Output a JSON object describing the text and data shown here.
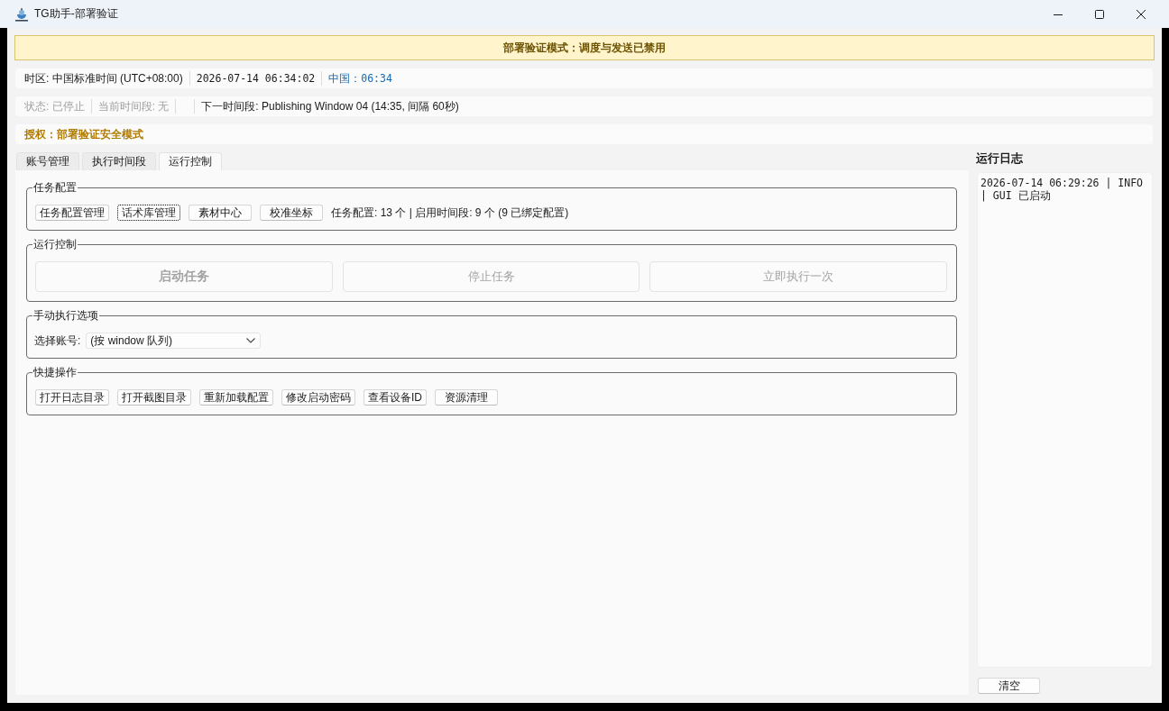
{
  "window": {
    "title": "TG助手-部署验证"
  },
  "banner": {
    "text": "部署验证模式：调度与发送已禁用"
  },
  "clock_bar": {
    "timezone": "时区: 中国标准时间 (UTC+08:00)",
    "datetime": "2026-07-14 06:34:02",
    "region_label": "中国：",
    "region_time": "06:34"
  },
  "status_bar": {
    "segments": [
      {
        "kind": "text",
        "text": "状态: 已停止",
        "disabled": true
      },
      {
        "kind": "text",
        "text": "当前时间段: 无",
        "disabled": true
      },
      {
        "kind": "blank"
      },
      {
        "kind": "text",
        "text": "下一时间段: Publishing Window 04 (14:35, 间隔 60秒)",
        "disabled": false
      }
    ]
  },
  "license": {
    "text": "授权：部署验证安全模式"
  },
  "tabs": [
    {
      "label": "账号管理",
      "selected": false
    },
    {
      "label": "执行时间段",
      "selected": false
    },
    {
      "label": "运行控制",
      "selected": true
    }
  ],
  "groups": [
    {
      "kind": "buttons",
      "title": "任务配置",
      "buttons": [
        {
          "label": "任务配置管理",
          "focused": false
        },
        {
          "label": "话术库管理",
          "focused": true
        },
        {
          "label": "素材中心",
          "focused": false
        },
        {
          "label": "校准坐标",
          "focused": false
        }
      ],
      "summary": "任务配置: 13 个 | 启用时间段: 9 个 (9 已绑定配置)"
    },
    {
      "kind": "actions",
      "title": "运行控制",
      "buttons": [
        {
          "label": "启动任务",
          "primary": true,
          "disabled": true
        },
        {
          "label": "停止任务",
          "primary": false,
          "disabled": true
        },
        {
          "label": "立即执行一次",
          "primary": false,
          "disabled": true
        }
      ]
    },
    {
      "kind": "select",
      "title": "手动执行选项",
      "label": "选择账号:",
      "value": "(按 window 队列)"
    },
    {
      "kind": "buttons",
      "title": "快捷操作",
      "buttons": [
        {
          "label": "打开日志目录",
          "focused": false
        },
        {
          "label": "打开截图目录",
          "focused": false
        },
        {
          "label": "重新加载配置",
          "focused": false
        },
        {
          "label": "修改启动密码",
          "focused": false
        },
        {
          "label": "查看设备ID",
          "focused": false
        },
        {
          "label": "资源清理",
          "focused": false
        }
      ]
    }
  ],
  "log": {
    "title": "运行日志",
    "lines": [
      "2026-07-14 06:29:26 | INFO | GUI 已启动"
    ]
  },
  "clear_button": {
    "label": "清空"
  }
}
